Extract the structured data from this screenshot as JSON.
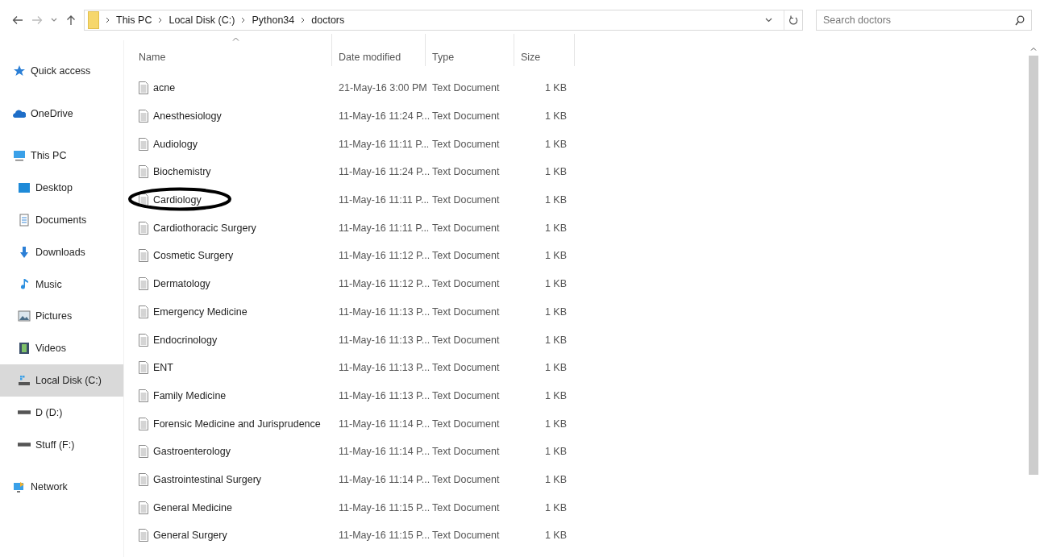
{
  "address_bar": {
    "path": [
      "This PC",
      "Local Disk (C:)",
      "Python34",
      "doctors"
    ]
  },
  "search": {
    "placeholder": "Search doctors"
  },
  "sidebar": {
    "items": [
      {
        "label": "Quick access",
        "kind": "star",
        "selected": false
      },
      {
        "label": "OneDrive",
        "kind": "cloud",
        "selected": false
      },
      {
        "label": "This PC",
        "kind": "computer",
        "selected": false,
        "children": [
          {
            "label": "Desktop",
            "kind": "desktop",
            "selected": false
          },
          {
            "label": "Documents",
            "kind": "documents",
            "selected": false
          },
          {
            "label": "Downloads",
            "kind": "downloads",
            "selected": false
          },
          {
            "label": "Music",
            "kind": "music",
            "selected": false
          },
          {
            "label": "Pictures",
            "kind": "pictures",
            "selected": false
          },
          {
            "label": "Videos",
            "kind": "videos",
            "selected": false
          },
          {
            "label": "Local Disk (C:)",
            "kind": "sysdrive",
            "selected": true
          },
          {
            "label": "D (D:)",
            "kind": "drive",
            "selected": false
          },
          {
            "label": "Stuff (F:)",
            "kind": "drive",
            "selected": false
          }
        ]
      },
      {
        "label": "Network",
        "kind": "network",
        "selected": false
      }
    ]
  },
  "table": {
    "columns": [
      {
        "label": "Name",
        "sorted": true
      },
      {
        "label": "Date modified",
        "sorted": false
      },
      {
        "label": "Type",
        "sorted": false
      },
      {
        "label": "Size",
        "sorted": false
      }
    ],
    "rows": [
      {
        "name": "acne",
        "date": "21-May-16 3:00 PM",
        "type": "Text Document",
        "size": "1 KB",
        "circled": false
      },
      {
        "name": "Anesthesiology",
        "date": "11-May-16 11:24 P...",
        "type": "Text Document",
        "size": "1 KB",
        "circled": false
      },
      {
        "name": "Audiology",
        "date": "11-May-16 11:11 P...",
        "type": "Text Document",
        "size": "1 KB",
        "circled": false
      },
      {
        "name": "Biochemistry",
        "date": "11-May-16 11:24 P...",
        "type": "Text Document",
        "size": "1 KB",
        "circled": false
      },
      {
        "name": "Cardiology",
        "date": "11-May-16 11:11 P...",
        "type": "Text Document",
        "size": "1 KB",
        "circled": true
      },
      {
        "name": "Cardiothoracic Surgery",
        "date": "11-May-16 11:11 P...",
        "type": "Text Document",
        "size": "1 KB",
        "circled": false
      },
      {
        "name": "Cosmetic Surgery",
        "date": "11-May-16 11:12 P...",
        "type": "Text Document",
        "size": "1 KB",
        "circled": false
      },
      {
        "name": "Dermatology",
        "date": "11-May-16 11:12 P...",
        "type": "Text Document",
        "size": "1 KB",
        "circled": false
      },
      {
        "name": "Emergency Medicine",
        "date": "11-May-16 11:13 P...",
        "type": "Text Document",
        "size": "1 KB",
        "circled": false
      },
      {
        "name": "Endocrinology",
        "date": "11-May-16 11:13 P...",
        "type": "Text Document",
        "size": "1 KB",
        "circled": false
      },
      {
        "name": "ENT",
        "date": "11-May-16 11:13 P...",
        "type": "Text Document",
        "size": "1 KB",
        "circled": false
      },
      {
        "name": "Family Medicine",
        "date": "11-May-16 11:13 P...",
        "type": "Text Document",
        "size": "1 KB",
        "circled": false
      },
      {
        "name": "Forensic Medicine and Jurisprudence",
        "date": "11-May-16 11:14 P...",
        "type": "Text Document",
        "size": "1 KB",
        "circled": false
      },
      {
        "name": "Gastroenterology",
        "date": "11-May-16 11:14 P...",
        "type": "Text Document",
        "size": "1 KB",
        "circled": false
      },
      {
        "name": "Gastrointestinal Surgery",
        "date": "11-May-16 11:14 P...",
        "type": "Text Document",
        "size": "1 KB",
        "circled": false
      },
      {
        "name": "General Medicine",
        "date": "11-May-16 11:15 P...",
        "type": "Text Document",
        "size": "1 KB",
        "circled": false
      },
      {
        "name": "General Surgery",
        "date": "11-May-16 11:15 P...",
        "type": "Text Document",
        "size": "1 KB",
        "circled": false
      }
    ]
  }
}
